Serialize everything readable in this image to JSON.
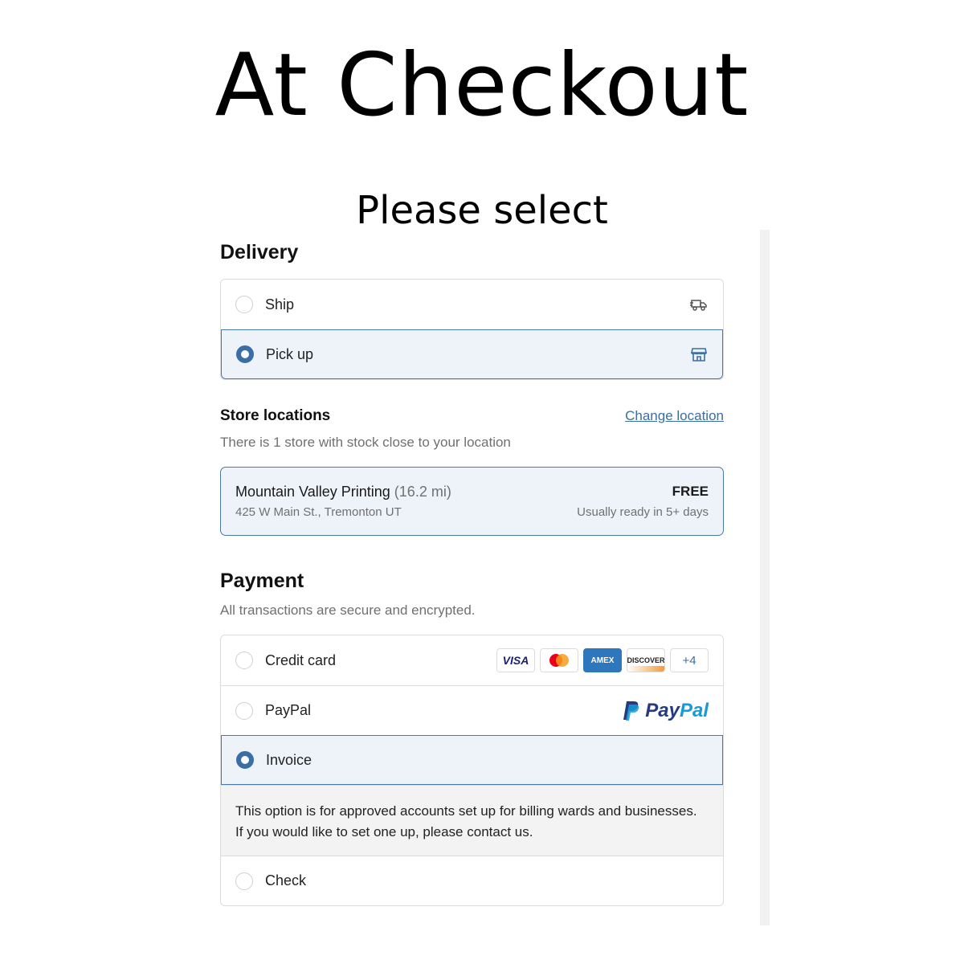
{
  "headline": "At Checkout",
  "subheadline": "Please select",
  "delivery": {
    "title": "Delivery",
    "options": [
      {
        "label": "Ship",
        "selected": false,
        "icon": "truck-icon"
      },
      {
        "label": "Pick up",
        "selected": true,
        "icon": "store-icon"
      }
    ]
  },
  "store": {
    "title": "Store locations",
    "change_link": "Change location",
    "subtitle": "There is 1 store with stock close to your location",
    "name": "Mountain Valley Printing",
    "distance": "(16.2 mi)",
    "address": "425 W Main St., Tremonton UT",
    "price": "FREE",
    "ready": "Usually ready in 5+ days"
  },
  "payment": {
    "title": "Payment",
    "subtitle": "All transactions are secure and encrypted.",
    "options": [
      {
        "label": "Credit card",
        "selected": false
      },
      {
        "label": "PayPal",
        "selected": false
      },
      {
        "label": "Invoice",
        "selected": true
      },
      {
        "label": "Check",
        "selected": false
      }
    ],
    "card_brands": [
      "VISA",
      "",
      "AMEX",
      "DISCOVER",
      "+4"
    ],
    "paypal_logo": {
      "pay": "Pay",
      "pal": "Pal"
    },
    "invoice_info_line1": "This option is for approved accounts set up for billing wards and businesses.",
    "invoice_info_line2": "If you would like to set one up, please contact us."
  },
  "colors": {
    "accent": "#3b6ea5",
    "selected_bg": "#eef3f9",
    "border": "#dcdcdc"
  }
}
